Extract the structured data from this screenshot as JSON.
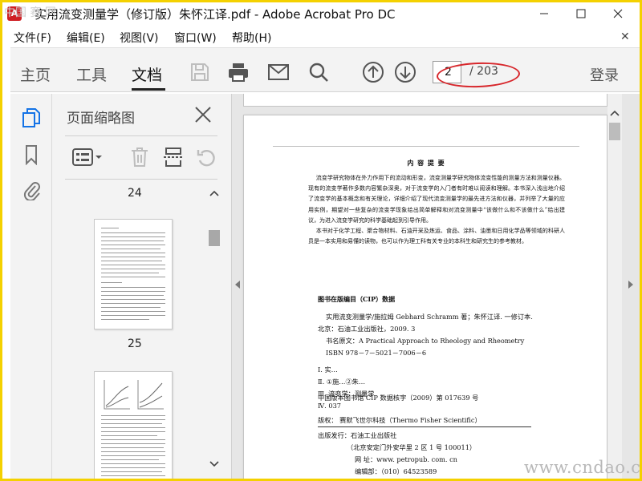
{
  "window": {
    "title": "实用流变测量学（修订版）朱怀江译.pdf - Adobe Acrobat Pro DC",
    "app_icon": "acrobat-icon",
    "accent": "#cf1e23"
  },
  "menu": {
    "items": [
      "文件(F)",
      "编辑(E)",
      "视图(V)",
      "窗口(W)",
      "帮助(H)"
    ]
  },
  "toolbar": {
    "nav": [
      "主页",
      "工具",
      "文档"
    ],
    "active_nav": "文档",
    "page_current": "2",
    "page_total": "/ 203",
    "login": "登录",
    "annotation_color": "#d7262b"
  },
  "panel": {
    "title": "页面缩略图",
    "thumbnails": [
      {
        "label": "24"
      },
      {
        "label": "25"
      }
    ]
  },
  "document": {
    "heading": "内 容 提 要",
    "abstract": [
      "流变学研究物体在外力作用下的流动和形变，流变测量学研究物体流变性能的测量方法和测量仪器。现有的流变学著作多数内容繁杂深奥，对于流变学的入门者有时难以阅读和理解。本书深入浅出地介绍了流变学的基本概念和有关理论，详细介绍了现代流变测量学的最先进方法和仪器，并列举了大量的应用实例，期望对一些复杂的流变学现象给出简单解释和对流变测量中“该做什么和不该做什么”给出建议，为进入流变学研究的科学基础起到引导作用。",
      "本书对于化学工程、聚合物材料、石油开采及炼运、食品、涂料、油墨和日用化学品等领域的科研人员是一本实用和易懂的读物，也可以作为理工科有关专业的本科生和研究生的参考教材。"
    ],
    "cip_title": "图书在版编目（CIP）数据",
    "cip_lines": [
      "实用流变测量学/施拉姆 Gebhard Schramm 著；朱怀江译. 一修订本.",
      "北京：石油工业出版社，2009. 3",
      "书名原文：A Practical Approach to Rheology and Rheometry",
      "ISBN 978－7－5021－7006－6",
      "Ⅰ. 实…",
      "Ⅱ. ①施…②朱…",
      "Ⅲ. 流变学：测量学",
      "Ⅳ. 037"
    ],
    "cip_number": "中国版本图书馆 CIP 数据核字（2009）第 017639 号",
    "copyright": "版权：    赛默飞世尔科技（Thermo Fisher Scientific）",
    "publisher_lines": [
      "出版发行：石油工业出版社",
      "（北京安定门外安华里 2 区 1 号   100011）",
      "网    址：www. petropub. com. cn",
      "编辑部：（010）64523589"
    ]
  },
  "watermark": {
    "bottom": "www.cndao.com",
    "top_left": "中国 赛 网"
  }
}
